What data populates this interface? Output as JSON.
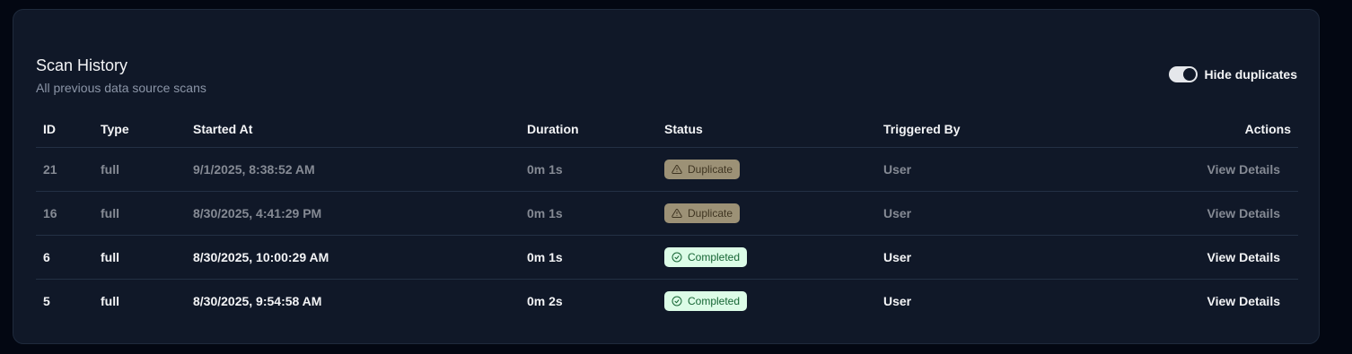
{
  "header": {
    "title": "Scan History",
    "subtitle": "All previous data source scans"
  },
  "toggle": {
    "label": "Hide duplicates",
    "checked": true
  },
  "table": {
    "columns": [
      "ID",
      "Type",
      "Started At",
      "Duration",
      "Status",
      "Triggered By",
      "Actions"
    ],
    "rows": [
      {
        "id": "21",
        "type": "full",
        "started": "9/1/2025, 8:38:52 AM",
        "duration": "0m 1s",
        "status": "Duplicate",
        "status_icon": "warning-icon",
        "triggered": "User",
        "action": "View Details"
      },
      {
        "id": "16",
        "type": "full",
        "started": "8/30/2025, 4:41:29 PM",
        "duration": "0m 1s",
        "status": "Duplicate",
        "status_icon": "warning-icon",
        "triggered": "User",
        "action": "View Details"
      },
      {
        "id": "6",
        "type": "full",
        "started": "8/30/2025, 10:00:29 AM",
        "duration": "0m 1s",
        "status": "Completed",
        "status_icon": "check-circle-icon",
        "triggered": "User",
        "action": "View Details"
      },
      {
        "id": "5",
        "type": "full",
        "started": "8/30/2025, 9:54:58 AM",
        "duration": "0m 2s",
        "status": "Completed",
        "status_icon": "check-circle-icon",
        "triggered": "User",
        "action": "View Details"
      }
    ]
  },
  "colors": {
    "background": "#030712",
    "card": "#101828",
    "duplicate_badge": "#9c9176",
    "completed_badge": "#dcfce7",
    "completed_text": "#166534"
  }
}
